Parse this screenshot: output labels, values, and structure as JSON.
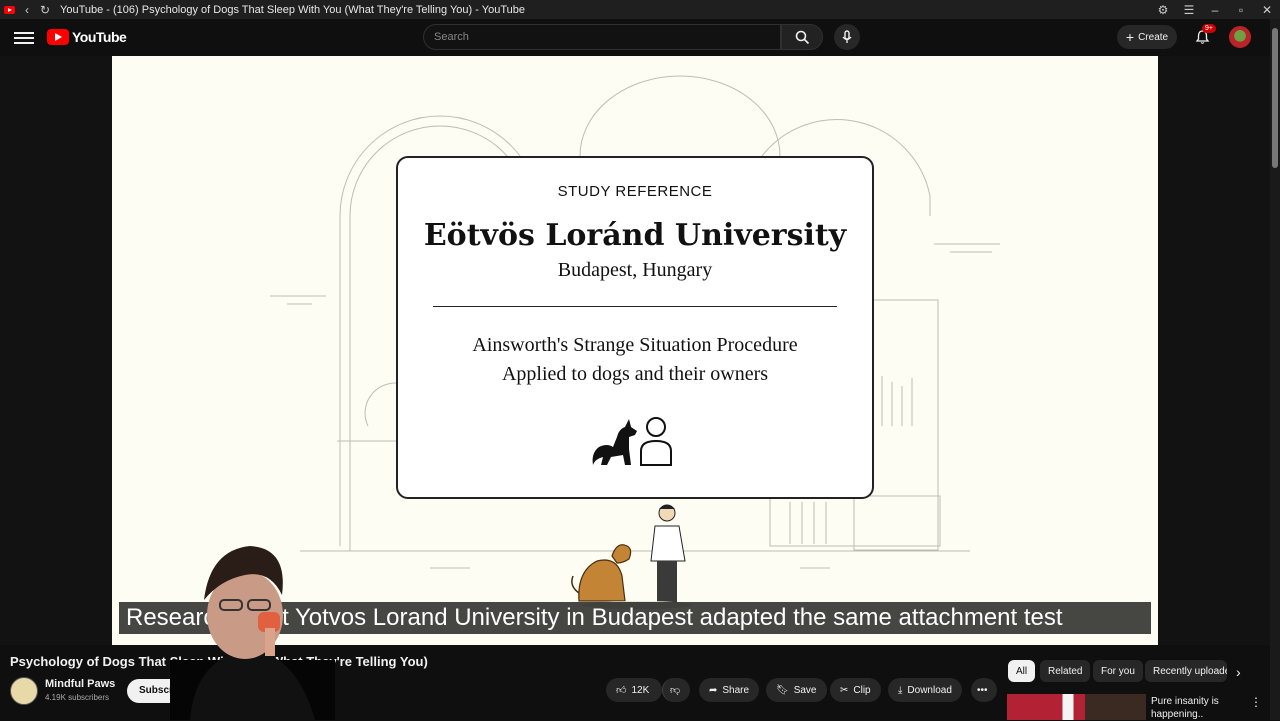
{
  "window": {
    "title": "YouTube - (106) Psychology of Dogs That Sleep With You (What They're Telling You) - YouTube"
  },
  "masthead": {
    "logo_text": "YouTube",
    "search_placeholder": "Search",
    "create_label": "Create",
    "notification_count": "9+"
  },
  "slide": {
    "heading": "STUDY REFERENCE",
    "university": "Eötvös Loránd University",
    "location": "Budapest, Hungary",
    "procedure_line1": "Ainsworth's Strange Situation Procedure",
    "procedure_line2": "Applied to dogs and their owners"
  },
  "caption": "Researchers at Yotvos Lorand University in Budapest adapted the same attachment test",
  "video": {
    "title": "Psychology of Dogs That Sleep With You (What They're Telling You)",
    "channel": "Mindful Paws",
    "subscribers": "4.19K subscribers",
    "subscribe_label": "Subscribe"
  },
  "actions": {
    "likes": "12K",
    "share": "Share",
    "save": "Save",
    "clip": "Clip",
    "download": "Download"
  },
  "chips": [
    "All",
    "Related",
    "For you",
    "Recently uploaded"
  ],
  "recommendation": {
    "title": "Pure insanity is happening.."
  }
}
